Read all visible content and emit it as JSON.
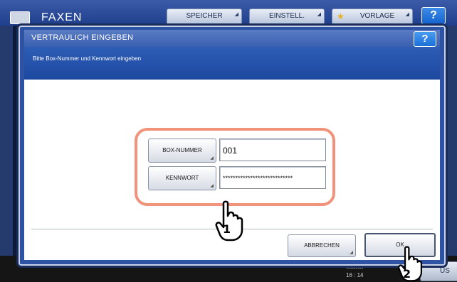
{
  "app": {
    "title": "FAXEN",
    "tabs": [
      {
        "label": "SPEICHER"
      },
      {
        "label": "EINSTELL."
      },
      {
        "label": "VORLAGE"
      }
    ],
    "help_label": "?",
    "clock": {
      "date": "---------",
      "time": "16 : 14"
    },
    "status_label": "US"
  },
  "dialog": {
    "title": "VERTRAULICH EINGEBEN",
    "help_label": "?",
    "message": "Bitte Box-Nummer und Kennwort eingeben",
    "fields": {
      "box_number": {
        "label": "BOX-NUMMER",
        "value": "001"
      },
      "password": {
        "label": "KENNWORT",
        "value": "****************************"
      }
    },
    "buttons": {
      "cancel": "ABBRECHEN",
      "ok": "OK"
    }
  },
  "annotations": {
    "step1": "1",
    "step2": "2"
  },
  "colors": {
    "dialog_blue": "#2f53a3",
    "highlight": "#f0937a"
  }
}
